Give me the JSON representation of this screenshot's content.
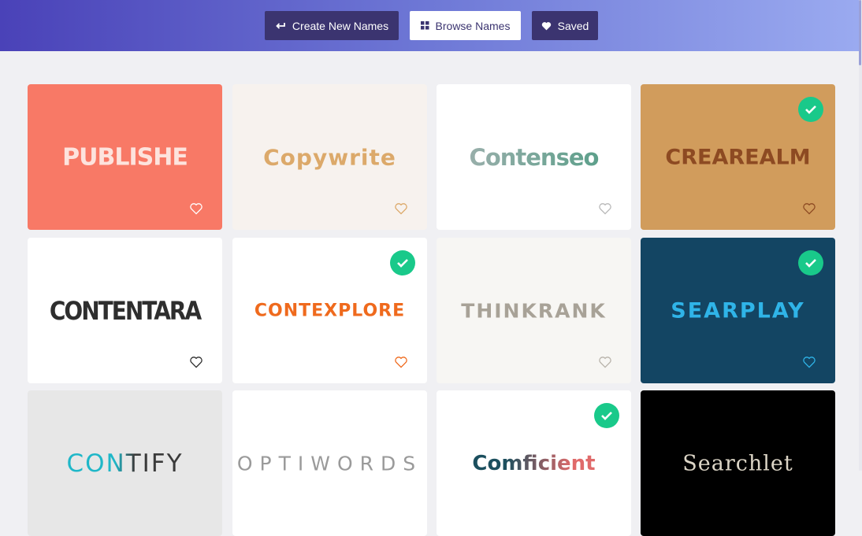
{
  "nav": {
    "create_label": "Create New Names",
    "browse_label": "Browse Names",
    "saved_label": "Saved",
    "create_icon": "arrow-return-icon",
    "browse_icon": "grid-icon",
    "saved_icon": "heart-filled-icon"
  },
  "colors": {
    "header_start": "#4a42b8",
    "header_end": "#9aaaf0",
    "button_dark": "#3b3470",
    "check_green": "#19c98a"
  },
  "cards": [
    {
      "name": "PUBLISHE",
      "bg": "#f87966",
      "saved": false
    },
    {
      "name": "Copywrite",
      "bg": "#f7f2ee",
      "saved": false
    },
    {
      "name": "Contenseo",
      "bg": "#ffffff",
      "saved": false
    },
    {
      "name": "CREAREALM",
      "bg": "#d19c5c",
      "saved": true
    },
    {
      "name": "CONTENTARA",
      "bg": "#ffffff",
      "saved": false
    },
    {
      "name": "CONTEXPLORE",
      "bg": "#ffffff",
      "saved": true
    },
    {
      "name": "THINKRANK",
      "bg": "#f7f6f3",
      "saved": false
    },
    {
      "name": "SEARPLAY",
      "bg": "#134563",
      "saved": true
    },
    {
      "name": "CONTIFY",
      "bg": "#e7e7e7",
      "saved": false
    },
    {
      "name": "OPTIWORDS",
      "bg": "#ffffff",
      "saved": false
    },
    {
      "name": "Comficient",
      "bg": "#ffffff",
      "saved": true
    },
    {
      "name": "Searchlet",
      "bg": "#000000",
      "saved": false
    }
  ]
}
